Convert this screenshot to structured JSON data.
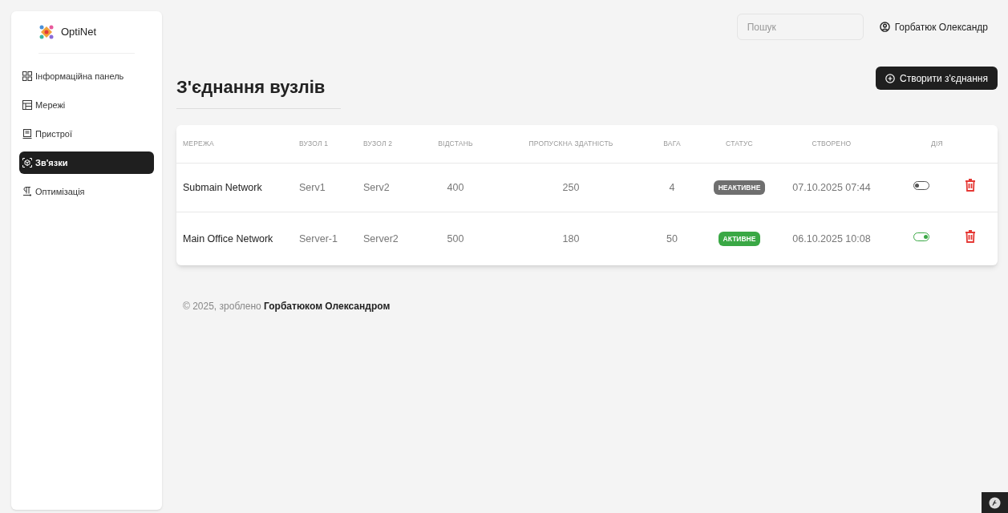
{
  "brand": {
    "name": "OptiNet"
  },
  "sidebar": {
    "items": [
      {
        "label": "Інформаційна панель",
        "kind": "grid",
        "selected": false
      },
      {
        "label": "Мережі",
        "kind": "table",
        "selected": false
      },
      {
        "label": "Пристрої",
        "kind": "device",
        "selected": false
      },
      {
        "label": "Зв'язки",
        "kind": "link",
        "selected": true
      },
      {
        "label": "Оптимізація",
        "kind": "optimize",
        "selected": false
      }
    ]
  },
  "search": {
    "placeholder": "Пошук"
  },
  "user": {
    "name": "Горбатюк Олександр"
  },
  "page": {
    "title": "З'єднання вузлів",
    "create_button": "Створити з'єднання"
  },
  "table": {
    "columns": [
      "МЕРЕЖА",
      "ВУЗОЛ 1",
      "ВУЗОЛ 2",
      "ВІДСТАНЬ",
      "ПРОПУСКНА ЗДАТНІСТЬ",
      "ВАГА",
      "СТАТУС",
      "СТВОРЕНО",
      "ДІЯ"
    ],
    "rows": [
      {
        "network": "Submain Network",
        "node1": "Serv1",
        "node2": "Serv2",
        "distance": "400",
        "bandwidth": "250",
        "weight": "4",
        "status": "НЕАКТИВНЕ",
        "active": false,
        "created": "07.10.2025 07:44",
        "on": false
      },
      {
        "network": "Main Office Network",
        "node1": "Server-1",
        "node2": "Server2",
        "distance": "500",
        "bandwidth": "180",
        "weight": "50",
        "status": "АКТИВНЕ",
        "active": true,
        "created": "06.10.2025 10:08",
        "on": true
      }
    ]
  },
  "footer": {
    "text": "© 2025, зроблено **Горбатюком Олександром**"
  }
}
